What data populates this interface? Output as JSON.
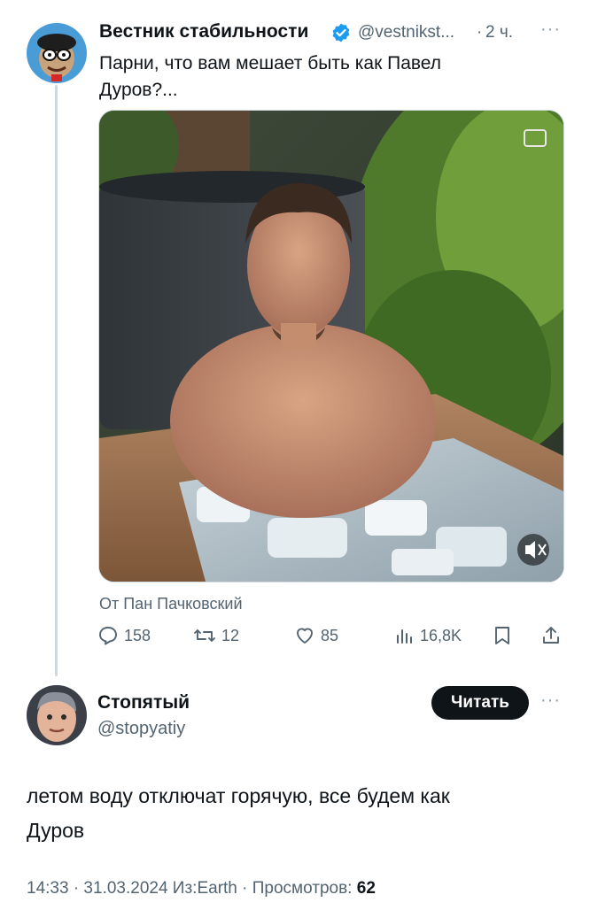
{
  "tweet": {
    "author_name": "Вестник стабильности",
    "handle": "@vestnikst...",
    "separator": "·",
    "time": "2 ч.",
    "text_line1": "Парни, что вам мешает быть как Павел",
    "text_line2": "Дуров?...",
    "attribution": "От Пан Пачковский",
    "stats": {
      "replies": "158",
      "retweets": "12",
      "likes": "85",
      "views": "16,8K"
    }
  },
  "reply": {
    "author_name": "Стопятый",
    "handle": "@stopyatiy",
    "follow_label": "Читать",
    "text_line1": "летом воду отключат горячую, все будем как",
    "text_line2": "Дуров",
    "meta_prefix": "14:33 · 31.03.2024 Из:Earth · Просмотров: ",
    "views": "62"
  },
  "colors": {
    "verified": "#1d9bf0",
    "muted": "#536471",
    "button_bg": "#0f1419"
  }
}
